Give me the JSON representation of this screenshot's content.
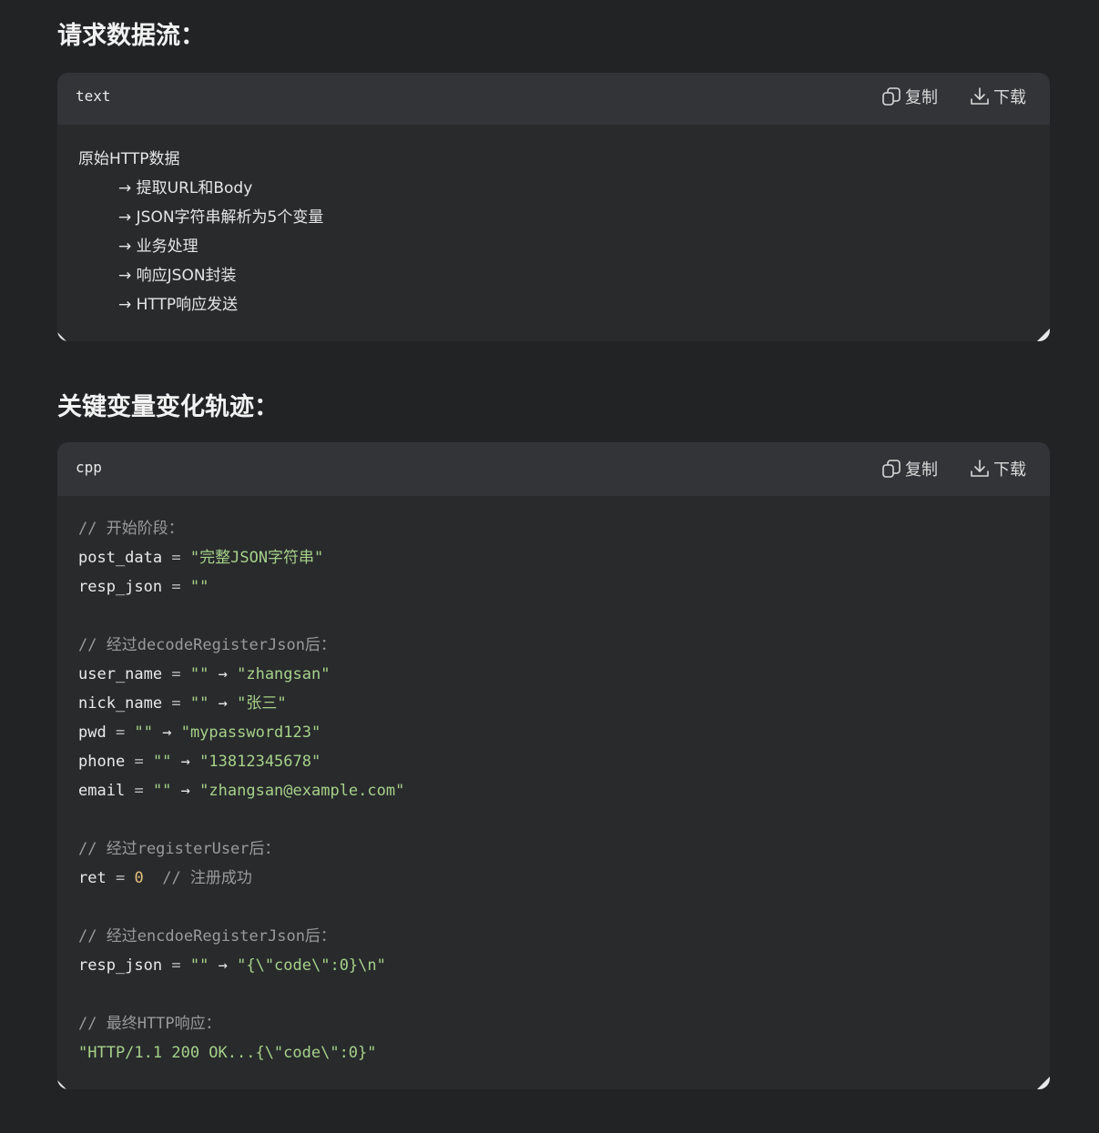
{
  "sections": [
    {
      "title": "请求数据流：",
      "block": {
        "language": "text",
        "copy_label": "复制",
        "download_label": "下载",
        "lines": {
          "l0": "原始HTTP数据",
          "l1": "→ 提取URL和Body",
          "l2": "→ JSON字符串解析为5个变量",
          "l3": "→ 业务处理",
          "l4": "→ 响应JSON封装",
          "l5": "→ HTTP响应发送"
        }
      }
    },
    {
      "title": "关键变量变化轨迹：",
      "block": {
        "language": "cpp",
        "copy_label": "复制",
        "download_label": "下载",
        "code": {
          "c_start": "// 开始阶段：",
          "post_data_name": "post_data",
          "post_data_val": "\"完整JSON字符串\"",
          "resp_json_name": "resp_json",
          "empty": "\"\"",
          "c_decode": "// 经过decodeRegisterJson后：",
          "user_name_name": "user_name",
          "user_name_val": "\"zhangsan\"",
          "nick_name_name": "nick_name",
          "nick_name_val": "\"张三\"",
          "pwd_name": "pwd",
          "pwd_val": "\"mypassword123\"",
          "phone_name": "phone",
          "phone_val": "\"13812345678\"",
          "email_name": "email",
          "email_val": "\"zhangsan@example.com\"",
          "c_register": "// 经过registerUser后：",
          "ret_name": "ret",
          "ret_val": "0",
          "ret_comment": "// 注册成功",
          "c_encode": "// 经过encdoeRegisterJson后：",
          "resp_json_val": "\"{\\\"code\\\":0}\\n\"",
          "c_final": "// 最终HTTP响应：",
          "http_val": "\"HTTP/1.1 200 OK...{\\\"code\\\":0}\""
        },
        "assign_op": "=",
        "arrow": "→"
      }
    }
  ]
}
